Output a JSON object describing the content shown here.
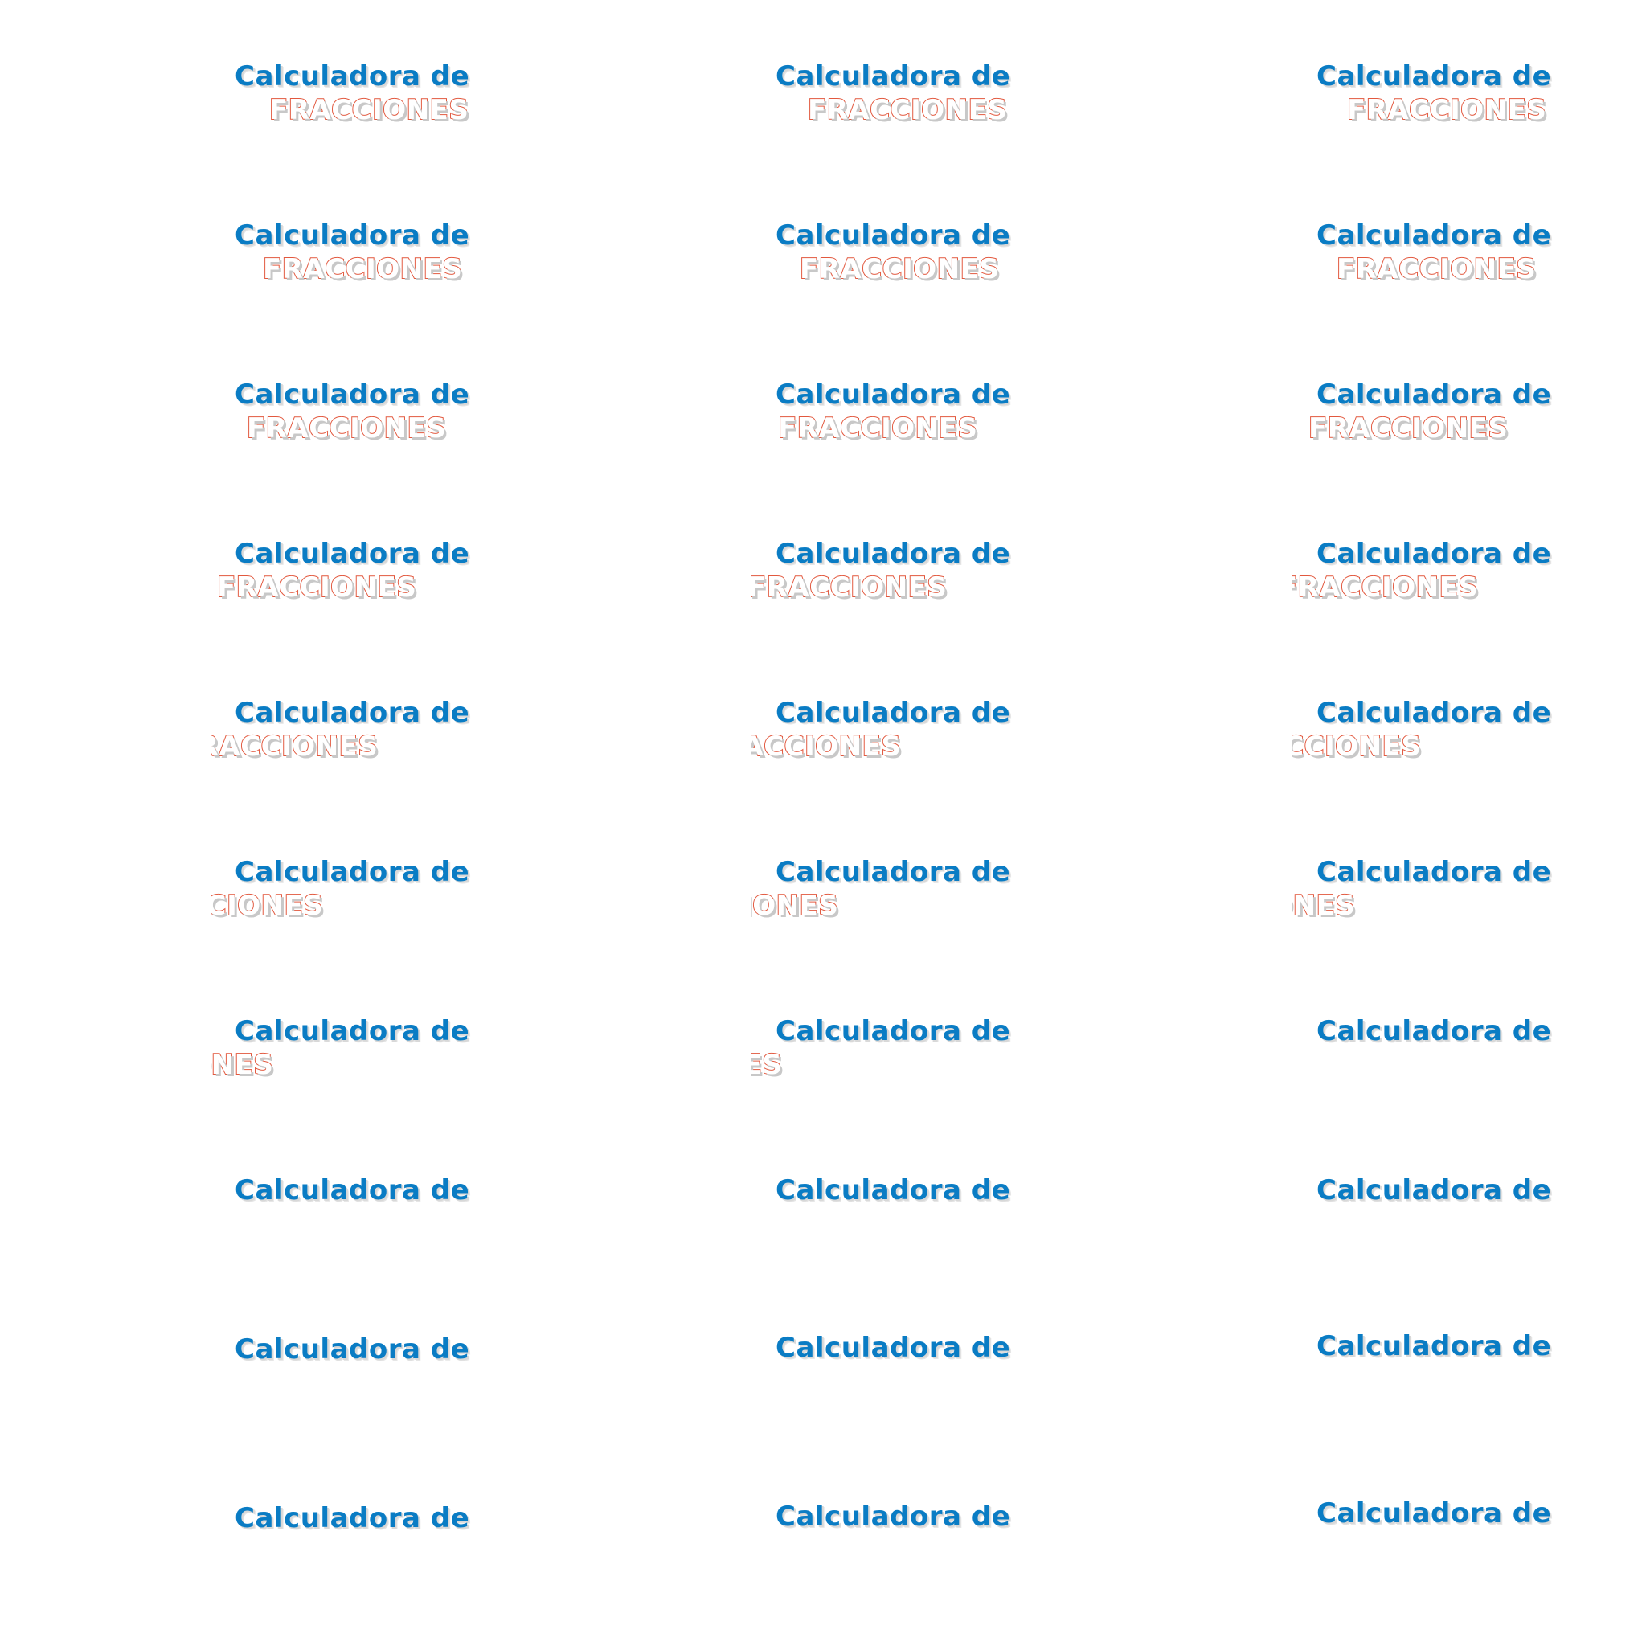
{
  "logo": {
    "line1": "Calculadora de",
    "line2": "FRACCIONES"
  },
  "colors": {
    "line1": "#0a7cc4",
    "line2_outline": "#e2583e",
    "line2_fill": "#ffffff",
    "background": "#ffffff"
  }
}
